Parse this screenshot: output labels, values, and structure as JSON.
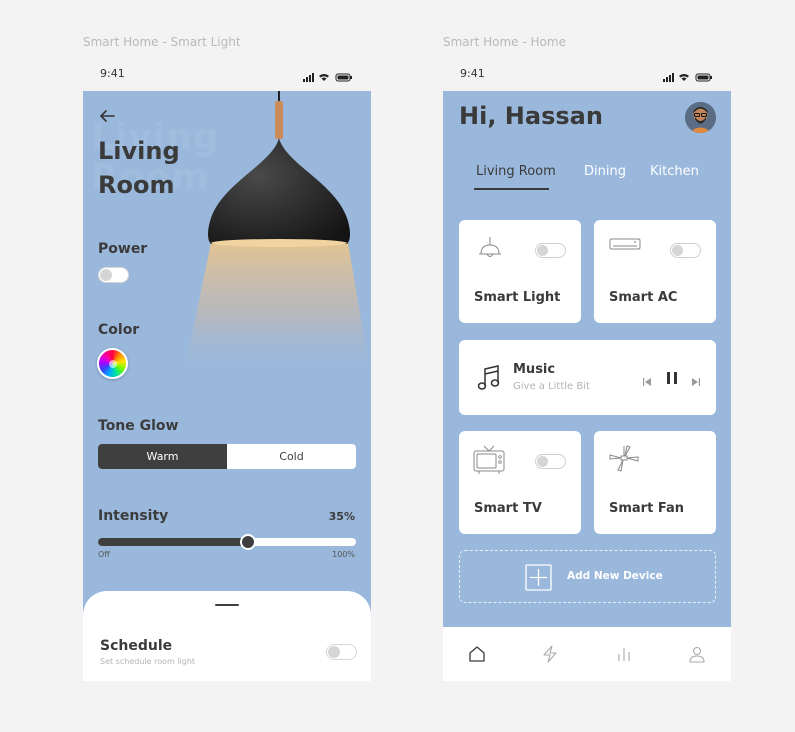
{
  "labels": {
    "left_frame": "Smart Home - Smart Light",
    "right_frame": "Smart Home - Home"
  },
  "status_bar": {
    "time": "9:41"
  },
  "smart_light": {
    "title_line1": "Living",
    "title_line2": "Room",
    "power_label": "Power",
    "power_on": false,
    "color_label": "Color",
    "tone_label": "Tone Glow",
    "tone_options": [
      "Warm",
      "Cold"
    ],
    "tone_selected": "Warm",
    "intensity_label": "Intensity",
    "intensity_value": "35%",
    "intensity_level": 0.58,
    "slider_min_label": "Off",
    "slider_max_label": "100%",
    "schedule_title": "Schedule",
    "schedule_subtitle": "Set schedule room light",
    "schedule_on": false
  },
  "home": {
    "greeting": "Hi, Hassan",
    "tabs": [
      "Living  Room",
      "Dining",
      "Kitchen"
    ],
    "active_tab": "Living  Room",
    "devices": [
      {
        "name": "Smart Light",
        "icon": "pendant-lamp-icon",
        "on": false
      },
      {
        "name": "Smart AC",
        "icon": "air-conditioner-icon",
        "on": false
      },
      {
        "name": "Smart TV",
        "icon": "tv-icon",
        "on": false
      },
      {
        "name": "Smart Fan",
        "icon": "ceiling-fan-icon"
      }
    ],
    "music": {
      "title": "Music",
      "subtitle": "Give a Little Bit",
      "icon": "music-note-icon"
    },
    "add_device_label": "Add New Device",
    "nav": [
      "home-icon",
      "lightning-icon",
      "stats-icon",
      "profile-icon"
    ]
  },
  "colors": {
    "background": "#9ab8dc",
    "dark": "#3f3f3f",
    "card": "#ffffff"
  }
}
